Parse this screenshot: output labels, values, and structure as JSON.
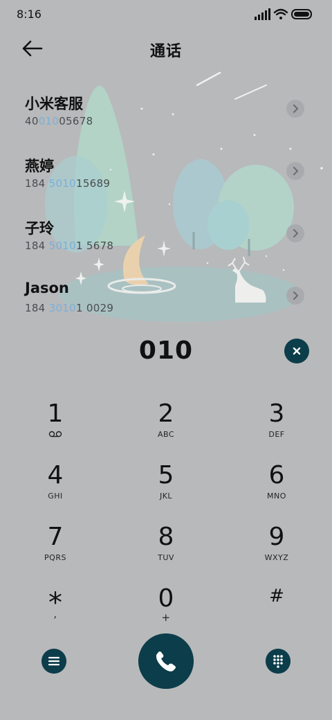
{
  "status_bar": {
    "time": "8:16",
    "icons": [
      "signal-icon",
      "wifi-icon",
      "battery-icon"
    ]
  },
  "header": {
    "back_icon": "back-arrow-icon",
    "title": "通话"
  },
  "contacts": [
    {
      "name": "小米客服",
      "number_prefix": "40",
      "number_match": "010",
      "number_suffix": "05678"
    },
    {
      "name": "燕婷",
      "number_prefix": "184 ",
      "number_match": "5010",
      "number_suffix": "15689"
    },
    {
      "name": "子玲",
      "number_prefix": "184 ",
      "number_match": "5010",
      "number_suffix": "1 5678"
    },
    {
      "name": "Jason",
      "number_prefix": "184 ",
      "number_match": "3010",
      "number_suffix": "1 0029"
    }
  ],
  "dial_entry": {
    "digits": "010",
    "clear_icon": "clear-x-icon"
  },
  "keypad": [
    {
      "num": "1",
      "sub": "",
      "icon": "voicemail-icon"
    },
    {
      "num": "2",
      "sub": "ABC"
    },
    {
      "num": "3",
      "sub": "DEF"
    },
    {
      "num": "4",
      "sub": "GHI"
    },
    {
      "num": "5",
      "sub": "JKL"
    },
    {
      "num": "6",
      "sub": "MNO"
    },
    {
      "num": "7",
      "sub": "PQRS"
    },
    {
      "num": "8",
      "sub": "TUV"
    },
    {
      "num": "9",
      "sub": "WXYZ"
    },
    {
      "num": "*",
      "sub": ","
    },
    {
      "num": "0",
      "sub": "+"
    },
    {
      "num": "#",
      "sub": ""
    }
  ],
  "bottom_bar": {
    "left_icon": "menu-icon",
    "center_icon": "phone-call-icon",
    "right_icon": "dialpad-grid-icon"
  },
  "colors": {
    "background": "#b8b9bb",
    "accent_dark": "#0c3d4a",
    "match_highlight": "#7ab0d8"
  }
}
